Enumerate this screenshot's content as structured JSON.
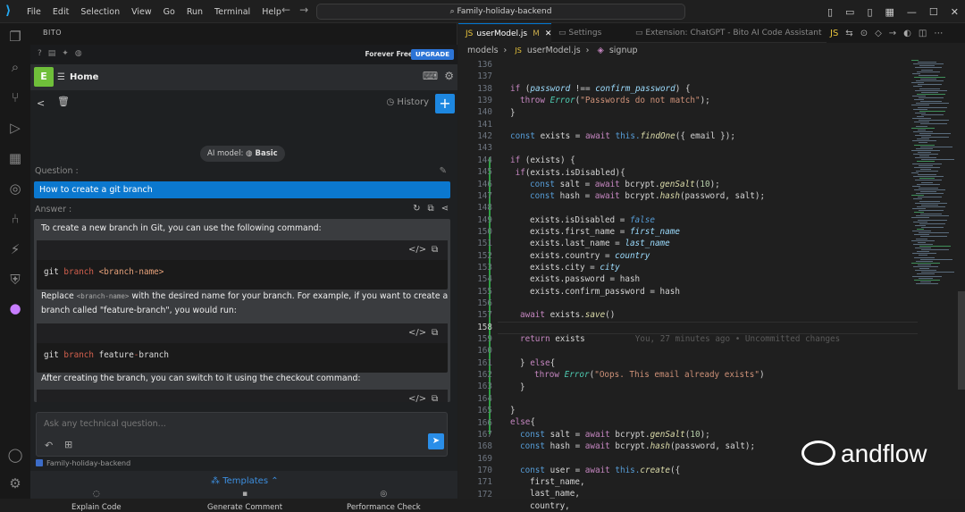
{
  "menu": [
    "File",
    "Edit",
    "Selection",
    "View",
    "Go",
    "Run",
    "Terminal",
    "Help"
  ],
  "search": {
    "text": "Family-holiday-backend"
  },
  "bito": {
    "header": "BITO",
    "forever": "Forever Free",
    "upgrade": "UPGRADE",
    "avatar_letter": "E",
    "home": "Home",
    "history": "History",
    "ai_model_label": "AI model:",
    "ai_model_value": "Basic",
    "question_label": "Question :",
    "question": "How to create a git branch",
    "answer_label": "Answer :",
    "answer": {
      "p1": "To create a new branch in Git, you can use the following command:",
      "code1": {
        "kw": "git",
        "kw2": "branch",
        "ph": "<branch-name>"
      },
      "p2a": "Replace",
      "p2code": "<branch-name>",
      "p2b": "with the desired name for your branch. For example, if you want to create a",
      "p2c": "branch called \"feature-branch\", you would run:",
      "code2": {
        "kw": "git",
        "kw2": "branch",
        "b1": "feature",
        "b2": "branch"
      },
      "p3": "After creating the branch, you can switch to it using the checkout command:"
    },
    "input_placeholder": "Ask any technical question...",
    "workspace": "Family-holiday-backend",
    "templates": "Templates",
    "template_items": [
      "Explain Code",
      "Generate Comment",
      "Performance Check"
    ]
  },
  "tabs": [
    {
      "label": "userModel.js",
      "mark": "M"
    },
    {
      "label": "Settings"
    },
    {
      "label": "Extension: ChatGPT - Bito AI Code Assistant"
    }
  ],
  "breadcrumb": [
    "models",
    "userModel.js",
    "signup"
  ],
  "line_numbers": [
    "136",
    "137",
    "138",
    "139",
    "140",
    "141",
    "142",
    "143",
    "144",
    "145",
    "146",
    "147",
    "148",
    "149",
    "150",
    "151",
    "152",
    "153",
    "154",
    "155",
    "156",
    "157",
    "158",
    "159",
    "160",
    "161",
    "162",
    "163",
    "164",
    "165",
    "166",
    "167",
    "168",
    "169",
    "170",
    "171",
    "172"
  ],
  "current_line": "158",
  "code": {
    "l137": {
      "k": "if",
      "a": " (",
      "p1": "password",
      "op": " !== ",
      "p2": "confirm_password",
      "b": ") {"
    },
    "l138": {
      "k": "throw",
      "f": "Error",
      "s": "\"Passwords do not match\"",
      "e": ");"
    },
    "l139": "}",
    "l141": {
      "k": "const",
      "v": " exists = ",
      "k2": "await",
      "t": " this.",
      "f": "findOne",
      "e": "({ email });"
    },
    "l143": {
      "k": "if",
      "e": " (exists) {"
    },
    "l144": {
      "k": "if",
      "e": "(exists.isDisabled){"
    },
    "l145": {
      "k": "const",
      "v": " salt = ",
      "k2": "await",
      "o": " bcrypt.",
      "f": "genSalt",
      "a": "(",
      "n": "10",
      "e": ");"
    },
    "l146": {
      "k": "const",
      "v": " hash = ",
      "k2": "await",
      "o": " bcrypt.",
      "f": "hash",
      "e": "(password, salt);"
    },
    "l148": {
      "a": "exists.isDisabled = ",
      "i": "false"
    },
    "l149": {
      "a": "exists.first_name = ",
      "i": "first_name"
    },
    "l150": {
      "a": "exists.last_name = ",
      "i": "last_name"
    },
    "l151": {
      "a": "exists.country = ",
      "i": "country"
    },
    "l152": {
      "a": "exists.city = ",
      "i": "city"
    },
    "l153": {
      "a": "exists.password = hash"
    },
    "l154": {
      "a": "exists.confirm_password = hash"
    },
    "l156": {
      "k": "await",
      "a": " exists.",
      "f": "save",
      "e": "()"
    },
    "l158": {
      "k": "return",
      "a": " exists",
      "blame": "You, 27 minutes ago • Uncommitted changes"
    },
    "l160": {
      "a": "} ",
      "k": "else",
      "e": "{"
    },
    "l161": {
      "k": "throw",
      "f": "Error",
      "s": "\"Oops. This email already exists\"",
      "e": ")"
    },
    "l162": "}",
    "l164": "}",
    "l165": {
      "k": "else",
      "e": "{"
    },
    "l166": {
      "k": "const",
      "v": " salt = ",
      "k2": "await",
      "o": " bcrypt.",
      "f": "genSalt",
      "a": "(",
      "n": "10",
      "e": ");"
    },
    "l167": {
      "k": "const",
      "v": " hash = ",
      "k2": "await",
      "o": " bcrypt.",
      "f": "hash",
      "e": "(password, salt);"
    },
    "l169": {
      "k": "const",
      "v": " user = ",
      "k2": "await",
      "t": " this.",
      "f": "create",
      "e": "({"
    },
    "l170": "first_name,",
    "l171": "last_name,",
    "l172": "country,"
  },
  "watermark": "andflow"
}
